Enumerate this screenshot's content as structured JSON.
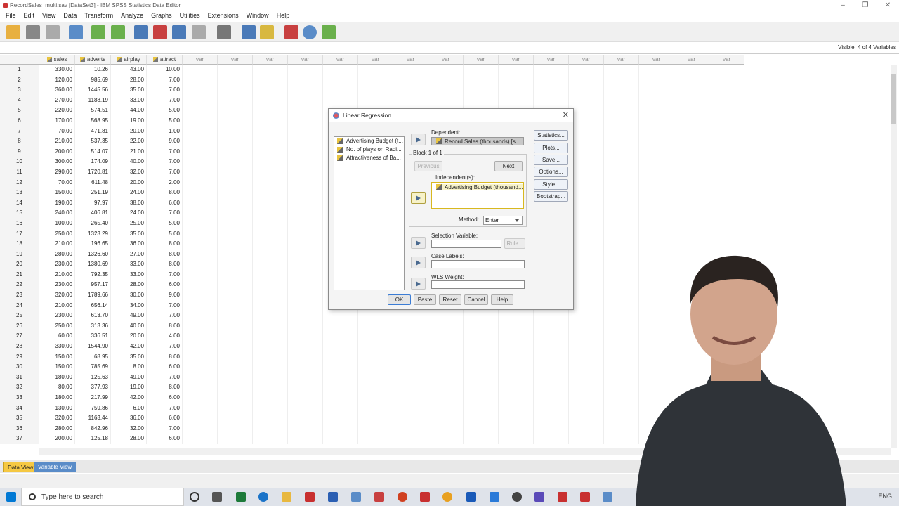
{
  "window": {
    "title": "RecordSales_multi.sav [DataSet3] - IBM SPSS Statistics Data Editor"
  },
  "menu": [
    "File",
    "Edit",
    "View",
    "Data",
    "Transform",
    "Analyze",
    "Graphs",
    "Utilities",
    "Extensions",
    "Window",
    "Help"
  ],
  "cellbar": {
    "visible_text": "Visible: 4 of 4 Variables"
  },
  "grid": {
    "columns": [
      "sales",
      "adverts",
      "airplay",
      "attract"
    ],
    "blank_column_label": "var",
    "rows": [
      [
        "1",
        "330.00",
        "10.26",
        "43.00",
        "10.00"
      ],
      [
        "2",
        "120.00",
        "985.69",
        "28.00",
        "7.00"
      ],
      [
        "3",
        "360.00",
        "1445.56",
        "35.00",
        "7.00"
      ],
      [
        "4",
        "270.00",
        "1188.19",
        "33.00",
        "7.00"
      ],
      [
        "5",
        "220.00",
        "574.51",
        "44.00",
        "5.00"
      ],
      [
        "6",
        "170.00",
        "568.95",
        "19.00",
        "5.00"
      ],
      [
        "7",
        "70.00",
        "471.81",
        "20.00",
        "1.00"
      ],
      [
        "8",
        "210.00",
        "537.35",
        "22.00",
        "9.00"
      ],
      [
        "9",
        "200.00",
        "514.07",
        "21.00",
        "7.00"
      ],
      [
        "10",
        "300.00",
        "174.09",
        "40.00",
        "7.00"
      ],
      [
        "11",
        "290.00",
        "1720.81",
        "32.00",
        "7.00"
      ],
      [
        "12",
        "70.00",
        "611.48",
        "20.00",
        "2.00"
      ],
      [
        "13",
        "150.00",
        "251.19",
        "24.00",
        "8.00"
      ],
      [
        "14",
        "190.00",
        "97.97",
        "38.00",
        "6.00"
      ],
      [
        "15",
        "240.00",
        "406.81",
        "24.00",
        "7.00"
      ],
      [
        "16",
        "100.00",
        "265.40",
        "25.00",
        "5.00"
      ],
      [
        "17",
        "250.00",
        "1323.29",
        "35.00",
        "5.00"
      ],
      [
        "18",
        "210.00",
        "196.65",
        "36.00",
        "8.00"
      ],
      [
        "19",
        "280.00",
        "1326.60",
        "27.00",
        "8.00"
      ],
      [
        "20",
        "230.00",
        "1380.69",
        "33.00",
        "8.00"
      ],
      [
        "21",
        "210.00",
        "792.35",
        "33.00",
        "7.00"
      ],
      [
        "22",
        "230.00",
        "957.17",
        "28.00",
        "6.00"
      ],
      [
        "23",
        "320.00",
        "1789.66",
        "30.00",
        "9.00"
      ],
      [
        "24",
        "210.00",
        "656.14",
        "34.00",
        "7.00"
      ],
      [
        "25",
        "230.00",
        "613.70",
        "49.00",
        "7.00"
      ],
      [
        "26",
        "250.00",
        "313.36",
        "40.00",
        "8.00"
      ],
      [
        "27",
        "60.00",
        "336.51",
        "20.00",
        "4.00"
      ],
      [
        "28",
        "330.00",
        "1544.90",
        "42.00",
        "7.00"
      ],
      [
        "29",
        "150.00",
        "68.95",
        "35.00",
        "8.00"
      ],
      [
        "30",
        "150.00",
        "785.69",
        "8.00",
        "6.00"
      ],
      [
        "31",
        "180.00",
        "125.63",
        "49.00",
        "7.00"
      ],
      [
        "32",
        "80.00",
        "377.93",
        "19.00",
        "8.00"
      ],
      [
        "33",
        "180.00",
        "217.99",
        "42.00",
        "6.00"
      ],
      [
        "34",
        "130.00",
        "759.86",
        "6.00",
        "7.00"
      ],
      [
        "35",
        "320.00",
        "1163.44",
        "36.00",
        "6.00"
      ],
      [
        "36",
        "280.00",
        "842.96",
        "32.00",
        "7.00"
      ],
      [
        "37",
        "200.00",
        "125.18",
        "28.00",
        "6.00"
      ]
    ]
  },
  "tabs": {
    "data_view": "Data View",
    "variable_view": "Variable View"
  },
  "taskbar": {
    "search_placeholder": "Type here to search",
    "lang": "ENG"
  },
  "dialog": {
    "title": "Linear Regression",
    "source_vars": [
      "Advertising Budget (t...",
      "No. of plays on Radi...",
      "Attractiveness of Ba..."
    ],
    "dependent_label": "Dependent:",
    "dependent_value": "Record Sales (thousands) [s...",
    "block_label": "Block 1 of 1",
    "previous": "Previous",
    "next": "Next",
    "independent_label": "Independent(s):",
    "independent_value": "Advertising Budget (thousand...",
    "method_label": "Method:",
    "method_value": "Enter",
    "selection_label": "Selection Variable:",
    "rule": "Rule...",
    "case_labels": "Case Labels:",
    "wls_label": "WLS Weight:",
    "side_buttons": [
      "Statistics...",
      "Plots...",
      "Save...",
      "Options...",
      "Style...",
      "Bootstrap..."
    ],
    "bottom_buttons": [
      "OK",
      "Paste",
      "Reset",
      "Cancel",
      "Help"
    ]
  }
}
